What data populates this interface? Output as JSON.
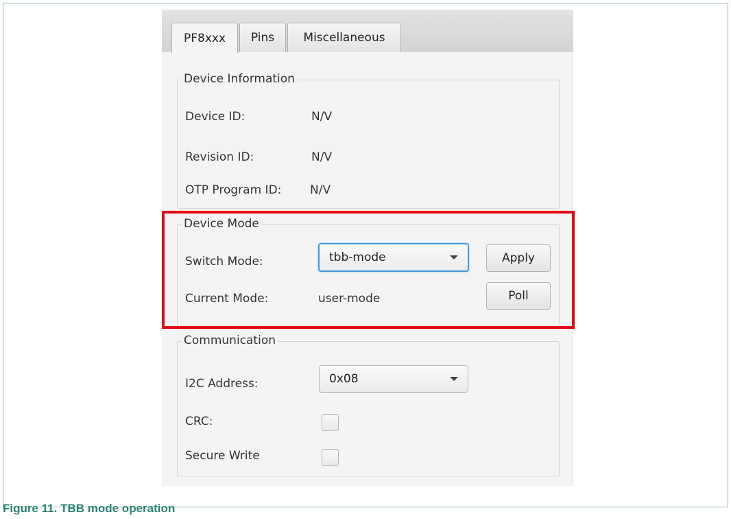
{
  "figure": {
    "caption": "Figure 11.  TBB mode operation",
    "highlight_color": "#e30613"
  },
  "tabs": [
    {
      "label": "PF8xxx",
      "selected": true
    },
    {
      "label": "Pins",
      "selected": false
    },
    {
      "label": "Miscellaneous",
      "selected": false
    }
  ],
  "device_information": {
    "title": "Device Information",
    "device_id_label": "Device ID:",
    "device_id_value": "N/V",
    "revision_id_label": "Revision ID:",
    "revision_id_value": "N/V",
    "otp_program_id_label": "OTP Program ID:",
    "otp_program_id_value": "N/V"
  },
  "device_mode": {
    "title": "Device Mode",
    "switch_mode_label": "Switch Mode:",
    "switch_mode_value": "tbb-mode",
    "apply_label": "Apply",
    "current_mode_label": "Current Mode:",
    "current_mode_value": "user-mode",
    "poll_label": "Poll"
  },
  "communication": {
    "title": "Communication",
    "i2c_address_label": "I2C Address:",
    "i2c_address_value": "0x08",
    "crc_label": "CRC:",
    "crc_checked": false,
    "secure_write_label": "Secure Write",
    "secure_write_checked": false
  },
  "colors": {
    "focus_border": "#3f9ad8",
    "caption_text": "#2a8074"
  },
  "icons": {
    "dropdown": "chevron-down-icon"
  }
}
